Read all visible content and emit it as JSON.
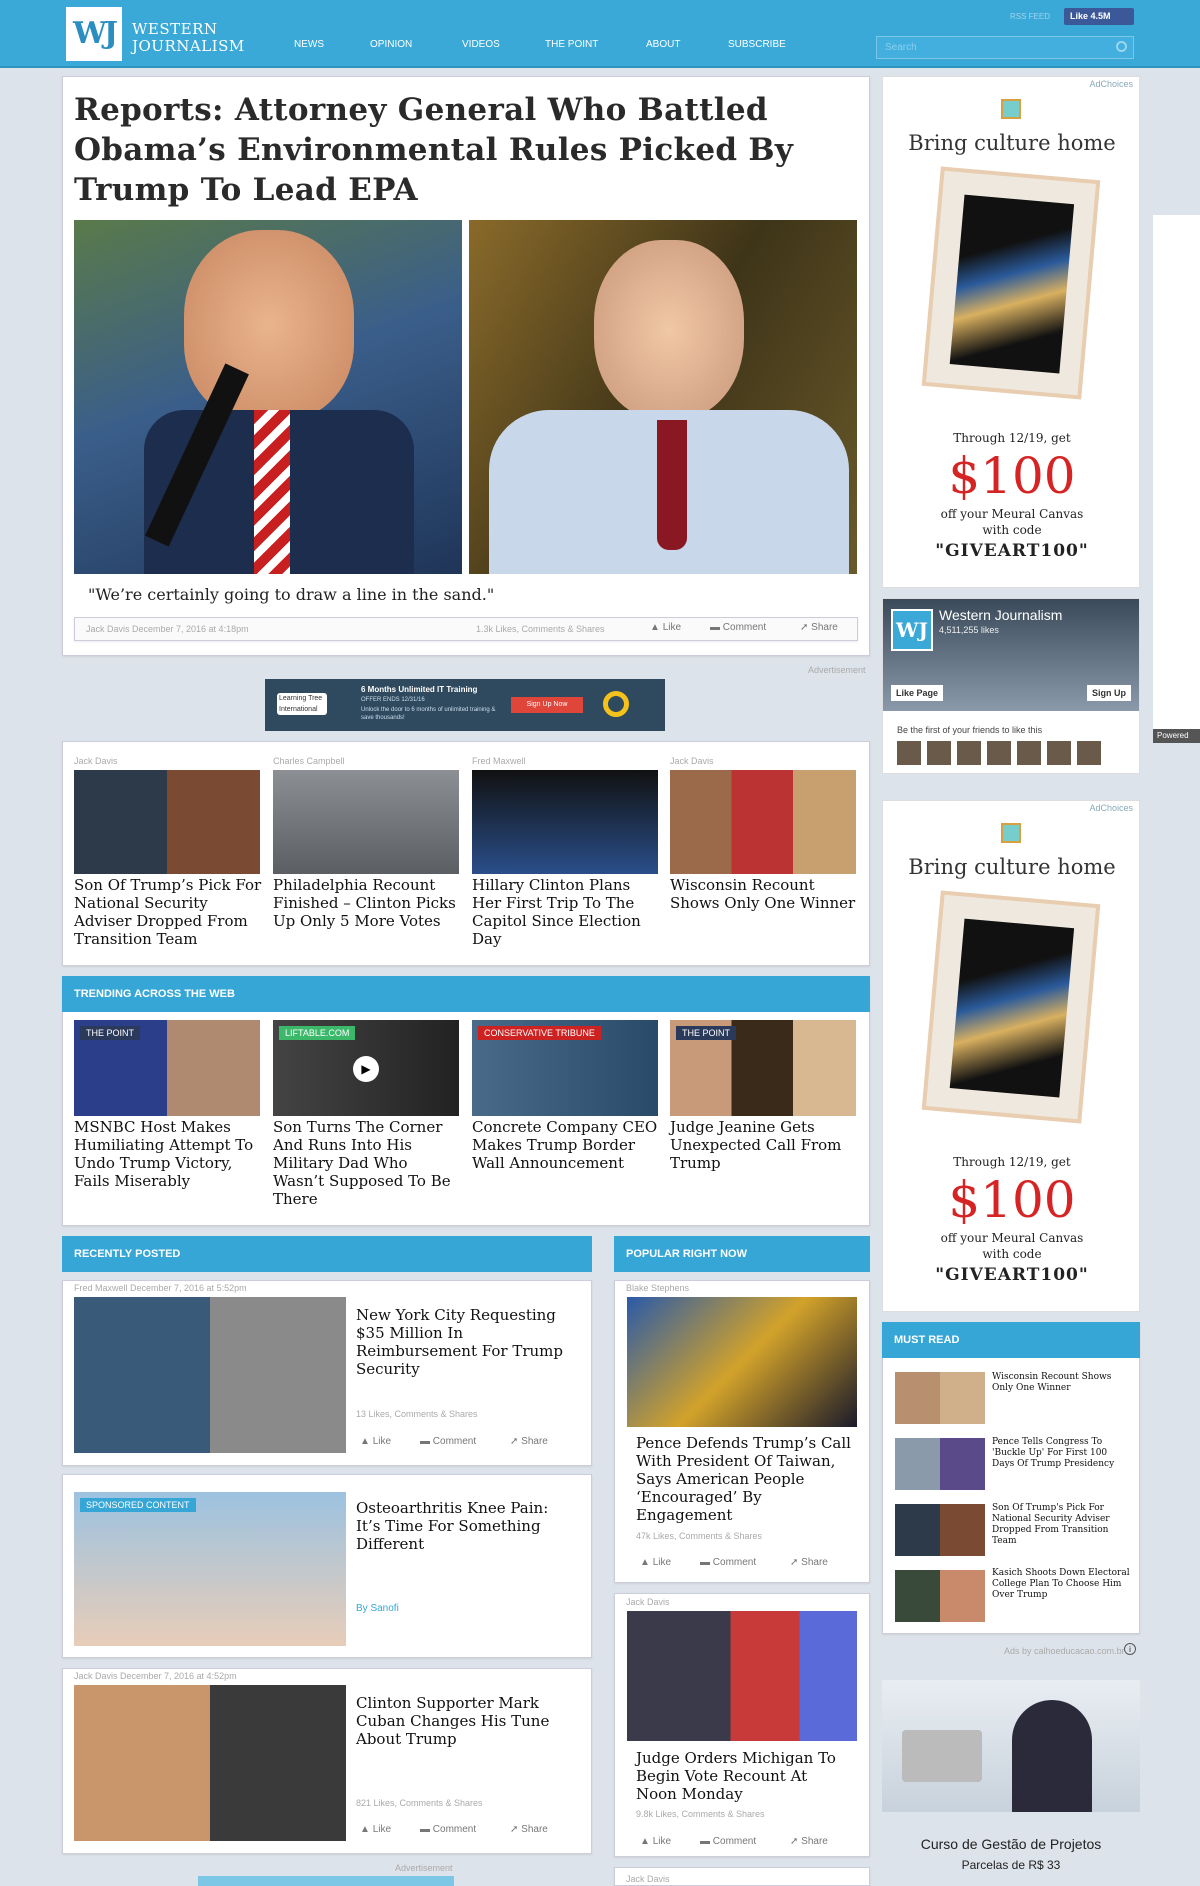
{
  "header": {
    "logo": "WJ",
    "brand_line1": "WESTERN",
    "brand_line2": "JOURNALISM",
    "nav": [
      "NEWS",
      "OPINION",
      "VIDEOS",
      "THE POINT",
      "ABOUT",
      "SUBSCRIBE"
    ],
    "rss": "RSS FEED",
    "like_label": "Like 4.5M",
    "search_placeholder": "Search"
  },
  "main": {
    "headline": "Reports: Attorney General Who Battled Obama’s Environmental Rules Picked By Trump To Lead EPA",
    "quote": "\"We’re certainly going to draw a line in the sand.\"",
    "byline": "Jack Davis December 7, 2016 at 4:18pm",
    "stats": "1.3k Likes, Comments & Shares",
    "like": "Like",
    "comment": "Comment",
    "share": "Share"
  },
  "advert_label": "Advertisement",
  "banner": {
    "title": "6 Months Unlimited IT Training",
    "offer": "OFFER ENDS 12/31/16",
    "desc": "Unlock the door to 6 months of unlimited training & save thousands!",
    "cta": "Sign Up Now",
    "logo": "Learning Tree International"
  },
  "grid": [
    {
      "author": "Jack Davis",
      "title": "Son Of Trump’s Pick For National Security Adviser Dropped From Transition Team"
    },
    {
      "author": "Charles Campbell",
      "title": "Philadelphia Recount Finished – Clinton Picks Up Only 5 More Votes"
    },
    {
      "author": "Fred Maxwell",
      "title": "Hillary Clinton Plans Her First Trip To The Capitol Since Election Day"
    },
    {
      "author": "Jack Davis",
      "title": "Wisconsin Recount Shows Only One Winner"
    }
  ],
  "trending": {
    "heading": "TRENDING ACROSS THE WEB",
    "items": [
      {
        "tag": "THE POINT",
        "title": "MSNBC Host Makes Humiliating Attempt To Undo Trump Victory, Fails Miserably"
      },
      {
        "tag": "LIFTABLE.COM",
        "title": "Son Turns The Corner And Runs Into His Military Dad Who Wasn’t Supposed To Be There"
      },
      {
        "tag": "CONSERVATIVE TRIBUNE",
        "title": "Concrete Company CEO Makes Trump Border Wall Announcement"
      },
      {
        "tag": "THE POINT",
        "title": "Judge Jeanine Gets Unexpected Call From Trump"
      }
    ]
  },
  "recent": {
    "heading": "RECENTLY POSTED",
    "items": [
      {
        "byline": "Fred Maxwell December 7, 2016 at 5:52pm",
        "title": "New York City Requesting $35 Million In Reimbursement For Trump Security",
        "stats": "13 Likes, Comments & Shares"
      },
      {
        "tag": "SPONSORED CONTENT",
        "title": "Osteoarthritis Knee Pain: It’s Time For Something Different",
        "sponsor": "By Sanofi"
      },
      {
        "byline": "Jack Davis December 7, 2016 at 4:52pm",
        "title": "Clinton Supporter Mark Cuban Changes His Tune About Trump",
        "stats": "821 Likes, Comments & Shares"
      }
    ]
  },
  "popular": {
    "heading": "POPULAR RIGHT NOW",
    "items": [
      {
        "author": "Blake Stephens",
        "title": "Pence Defends Trump’s Call With President Of Taiwan, Says American People ‘Encouraged’ By Engagement",
        "stats": "47k Likes, Comments & Shares"
      },
      {
        "author": "Jack Davis",
        "title": "Judge Orders Michigan To Begin Vote Recount At Noon Monday",
        "stats": "9.8k Likes, Comments & Shares"
      },
      {
        "author": "Jack Davis"
      }
    ]
  },
  "sidebar_ad": {
    "adchoices": "AdChoices",
    "headline": "Bring culture home",
    "line1": "Through 12/19, get",
    "price": "$100",
    "line2": "off your Meural Canvas",
    "line3": "with code",
    "code": "\"GIVEART100\""
  },
  "fb": {
    "page": "Western Journalism",
    "likes": "4,511,255 likes",
    "like_page": "Like Page",
    "sign_up": "Sign Up",
    "friends": "Be the first of your friends to like this"
  },
  "must_read": {
    "heading": "MUST READ",
    "items": [
      "Wisconsin Recount Shows Only One Winner",
      "Pence Tells Congress To 'Buckle Up' For First 100 Days Of Trump Presidency",
      "Son Of Trump's Pick For National Security Adviser Dropped From Transition Team",
      "Kasich Shoots Down Electoral College Plan To Choose Him Over Trump"
    ]
  },
  "bottom_ad": {
    "credit": "Ads by calhoeducacao.com.br",
    "title": "Curso de Gestão de Projetos",
    "sub": "Parcelas de R$ 33"
  },
  "edge_label": "Powered",
  "colors": {
    "header": "#3aa9d8",
    "accent": "#36a6d6",
    "price": "#d62424"
  }
}
